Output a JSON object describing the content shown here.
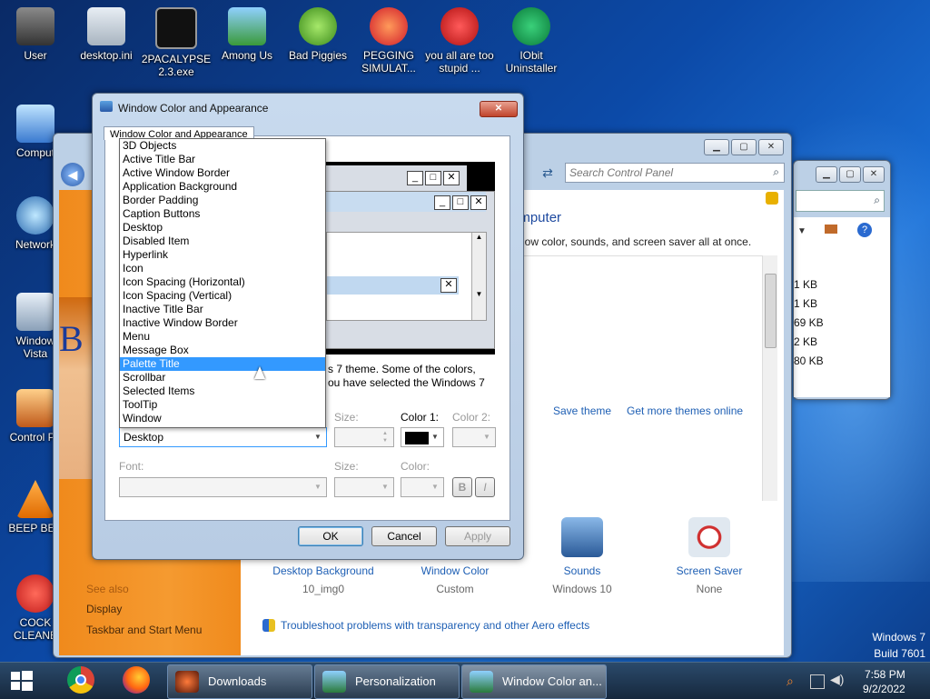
{
  "desktop": {
    "icons": [
      {
        "label": "User"
      },
      {
        "label": "desktop.ini"
      },
      {
        "label": "2PACALYPSE 2.3.exe"
      },
      {
        "label": "Among Us"
      },
      {
        "label": "Bad Piggies"
      },
      {
        "label": "PEGGING SIMULAT..."
      },
      {
        "label": "you all are too stupid ..."
      },
      {
        "label": "IObit Uninstaller"
      },
      {
        "label": "Comput"
      },
      {
        "label": "Network"
      },
      {
        "label": "Window Vista"
      },
      {
        "label": "Control Pa"
      },
      {
        "label": "BEEP BEE"
      },
      {
        "label": "COCK CLEANE"
      }
    ],
    "watermark_line1": "Windows 7",
    "watermark_line2": "Build 7601"
  },
  "control_panel": {
    "search_placeholder": "Search Control Panel",
    "heading_fragment": "omputer",
    "desc_fragment": "dow color, sounds, and screen saver all at once.",
    "save_theme": "Save theme",
    "more_themes": "Get more themes online",
    "bottom_items": [
      {
        "title": "Desktop Background",
        "value": "10_img0"
      },
      {
        "title": "Window Color",
        "value": "Custom"
      },
      {
        "title": "Sounds",
        "value": "Windows 10"
      },
      {
        "title": "Screen Saver",
        "value": "None"
      }
    ],
    "troubleshoot": "Troubleshoot problems with transparency and other Aero effects",
    "see_also": "See also",
    "sidebar_links": [
      "Display",
      "Taskbar and Start Menu"
    ]
  },
  "explorer": {
    "sizes": [
      "1 KB",
      "1 KB",
      "69 KB",
      "2 KB",
      "80 KB"
    ]
  },
  "dialog": {
    "title": "Window Color and Appearance",
    "tab": "Window Color and Appearance",
    "desc_part1": "s 7 theme.  Some of the colors,",
    "desc_part2": "ou have selected the Windows 7",
    "item_list": [
      "3D Objects",
      "Active Title Bar",
      "Active Window Border",
      "Application Background",
      "Border Padding",
      "Caption Buttons",
      "Desktop",
      "Disabled Item",
      "Hyperlink",
      "Icon",
      "Icon Spacing (Horizontal)",
      "Icon Spacing (Vertical)",
      "Inactive Title Bar",
      "Inactive Window Border",
      "Menu",
      "Message Box",
      "Palette Title",
      "Scrollbar",
      "Selected Items",
      "ToolTip",
      "Window"
    ],
    "highlighted_item": "Palette Title",
    "selected_item": "Desktop",
    "size_label": "Size:",
    "color1_label": "Color 1:",
    "color2_label": "Color 2:",
    "font_label": "Font:",
    "font_size_label": "Size:",
    "font_color_label": "Color:",
    "bold": "B",
    "italic": "I",
    "ok": "OK",
    "cancel": "Cancel",
    "apply": "Apply",
    "color1_value": "#000000"
  },
  "taskbar": {
    "tasks": [
      {
        "label": "Downloads"
      },
      {
        "label": "Personalization"
      },
      {
        "label": "Window Color an..."
      }
    ],
    "time": "7:58 PM",
    "date": "9/2/2022"
  },
  "colors": {
    "accent": "#3399ff",
    "link": "#1e5fb4",
    "orange": "#f08a1c"
  }
}
